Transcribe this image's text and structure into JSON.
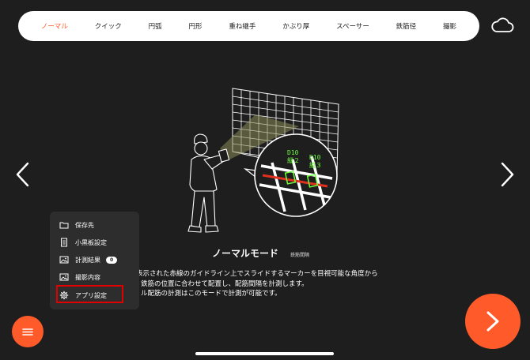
{
  "tabs": [
    {
      "label": "ノーマル",
      "active": true
    },
    {
      "label": "クイック"
    },
    {
      "label": "円弧"
    },
    {
      "label": "円形"
    },
    {
      "label": "重ね継手"
    },
    {
      "label": "かぶり厚"
    },
    {
      "label": "スペーサー"
    },
    {
      "label": "鉄筋径"
    },
    {
      "label": "撮影"
    }
  ],
  "icons": {
    "cloud": "cloud-icon",
    "prev": "chevron-left-icon",
    "next": "chevron-right-icon",
    "menu": "hamburger-icon"
  },
  "illustration": {
    "label_left_line1": "D10",
    "label_left_line2": "縦２",
    "label_right_line1": "D10",
    "label_right_line2": "縦３"
  },
  "mode": {
    "title": "ノーマルモード",
    "tag": "鉄筋間隔",
    "description": [
      "表示された赤線のガイドライン上でスライドするマーカーを目視可能な角度から",
      "鉄筋の位置に合わせて配置し、配筋間隔を計測します。",
      "ル配筋の計測はこのモードで計測が可能です。"
    ]
  },
  "menu": {
    "items": [
      {
        "label": "保存先",
        "icon": "folder-icon"
      },
      {
        "label": "小黒板設定",
        "icon": "document-icon"
      },
      {
        "label": "計測結果",
        "icon": "image-icon",
        "badge": "0"
      },
      {
        "label": "撮影内容",
        "icon": "image-icon"
      },
      {
        "label": "アプリ設定",
        "icon": "gear-icon"
      }
    ]
  },
  "colors": {
    "accent": "#ff5a2a",
    "background": "#1e1e1e",
    "panel": "#2d2d2d",
    "highlight": "#e00000",
    "label_green": "#6cff3a"
  }
}
